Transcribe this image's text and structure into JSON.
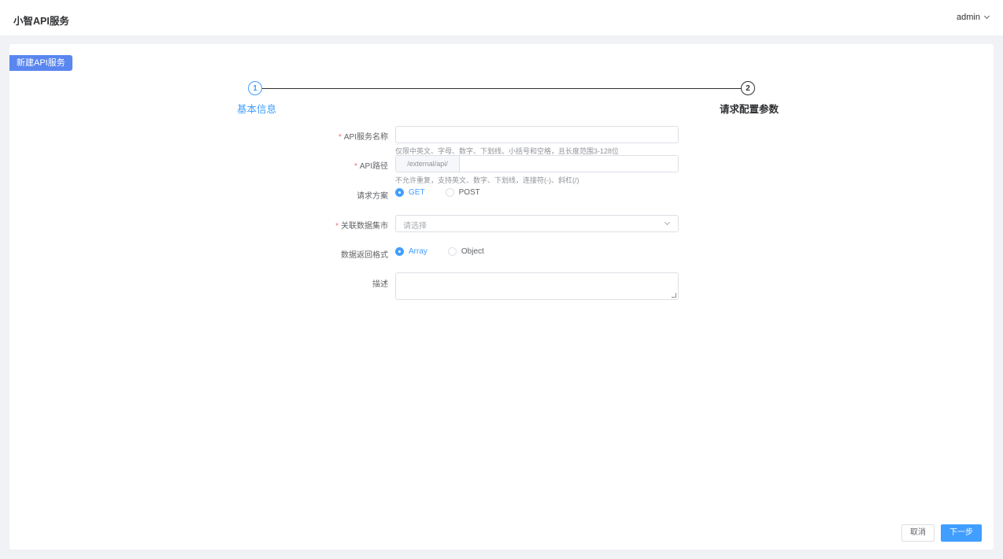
{
  "header": {
    "app_title": "小智API服务",
    "user": "admin"
  },
  "panel": {
    "tag": "新建API服务"
  },
  "steps": [
    {
      "number": "1",
      "title": "基本信息",
      "state": "active"
    },
    {
      "number": "2",
      "title": "请求配置参数",
      "state": "pending"
    }
  ],
  "form": {
    "service_name": {
      "label": "API服务名称",
      "required": "*",
      "value": "",
      "hint": "仅限中英文、字母、数字、下划线、小括号和空格，且长度范围3-128位"
    },
    "path": {
      "label": "API路径",
      "required": "*",
      "prefix": "/external/api/",
      "value": "",
      "hint": "不允许重复，支持英文、数字、下划线，连接符(-)、斜杠(/)"
    },
    "method": {
      "label": "请求方案",
      "options": [
        "GET",
        "POST"
      ],
      "selected": "GET"
    },
    "dataset": {
      "label": "关联数据集市",
      "required": "*",
      "placeholder": "请选择"
    },
    "format": {
      "label": "数据返回格式",
      "options": [
        "Array",
        "Object"
      ],
      "selected": "Array"
    },
    "description": {
      "label": "描述",
      "value": ""
    }
  },
  "buttons": {
    "cancel": "取消",
    "next": "下一步"
  },
  "colors": {
    "primary": "#409eff",
    "tag": "#5a86f0",
    "required": "#f56c6c"
  }
}
